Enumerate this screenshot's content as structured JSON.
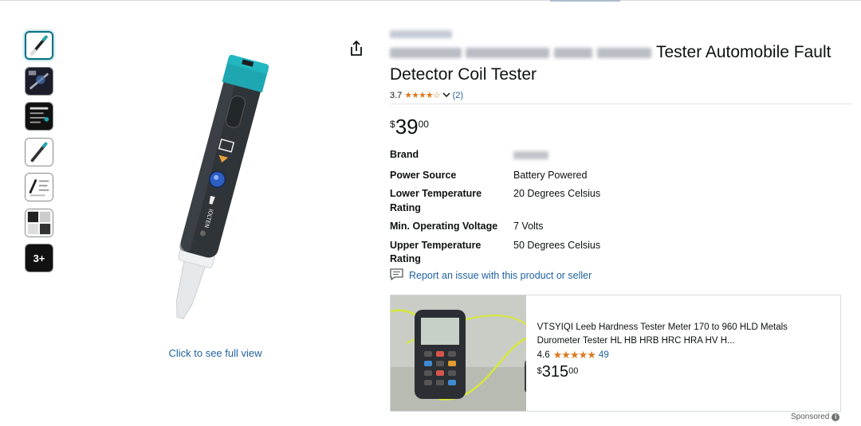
{
  "product": {
    "title_visible": "Tester Automobile Fault",
    "title_line2": "Detector Coil Tester",
    "rating_value": "3.7",
    "rating_stars": "★★★★☆",
    "rating_fill": 0.74,
    "rating_count": "(2)",
    "price_symbol": "$",
    "price_whole": "39",
    "price_fraction": "00",
    "full_view_link": "Click to see full view",
    "thumbnails_more_label": "3+"
  },
  "specs": [
    {
      "key": "Brand",
      "value": ""
    },
    {
      "key": "Power Source",
      "value": "Battery Powered"
    },
    {
      "key": "Lower Temperature Rating",
      "value": "20 Degrees Celsius"
    },
    {
      "key": "Min. Operating Voltage",
      "value": "7 Volts"
    },
    {
      "key": "Upper Temperature Rating",
      "value": "50 Degrees Celsius"
    }
  ],
  "report_link": "Report an issue with this product or seller",
  "sponsored_ad": {
    "title": "VTSYIQI Leeb Hardness Tester Meter 170 to 960 HLD Metals Durometer Tester HL HB HRB HRC HRA HV H...",
    "rating_value": "4.6",
    "rating_stars": "★★★★★",
    "rating_count": "49",
    "price_symbol": "$",
    "price_whole": "315",
    "price_fraction": "00",
    "sponsored_label": "Sponsored",
    "info_icon": "i"
  },
  "colors": {
    "link": "#2162a1",
    "star": "#de7921",
    "thumb_active_border": "#007185",
    "pen_teal": "#1fa7b1"
  },
  "icons": [
    "share-icon",
    "chevron-down-icon",
    "report-issue-icon",
    "info-icon"
  ]
}
